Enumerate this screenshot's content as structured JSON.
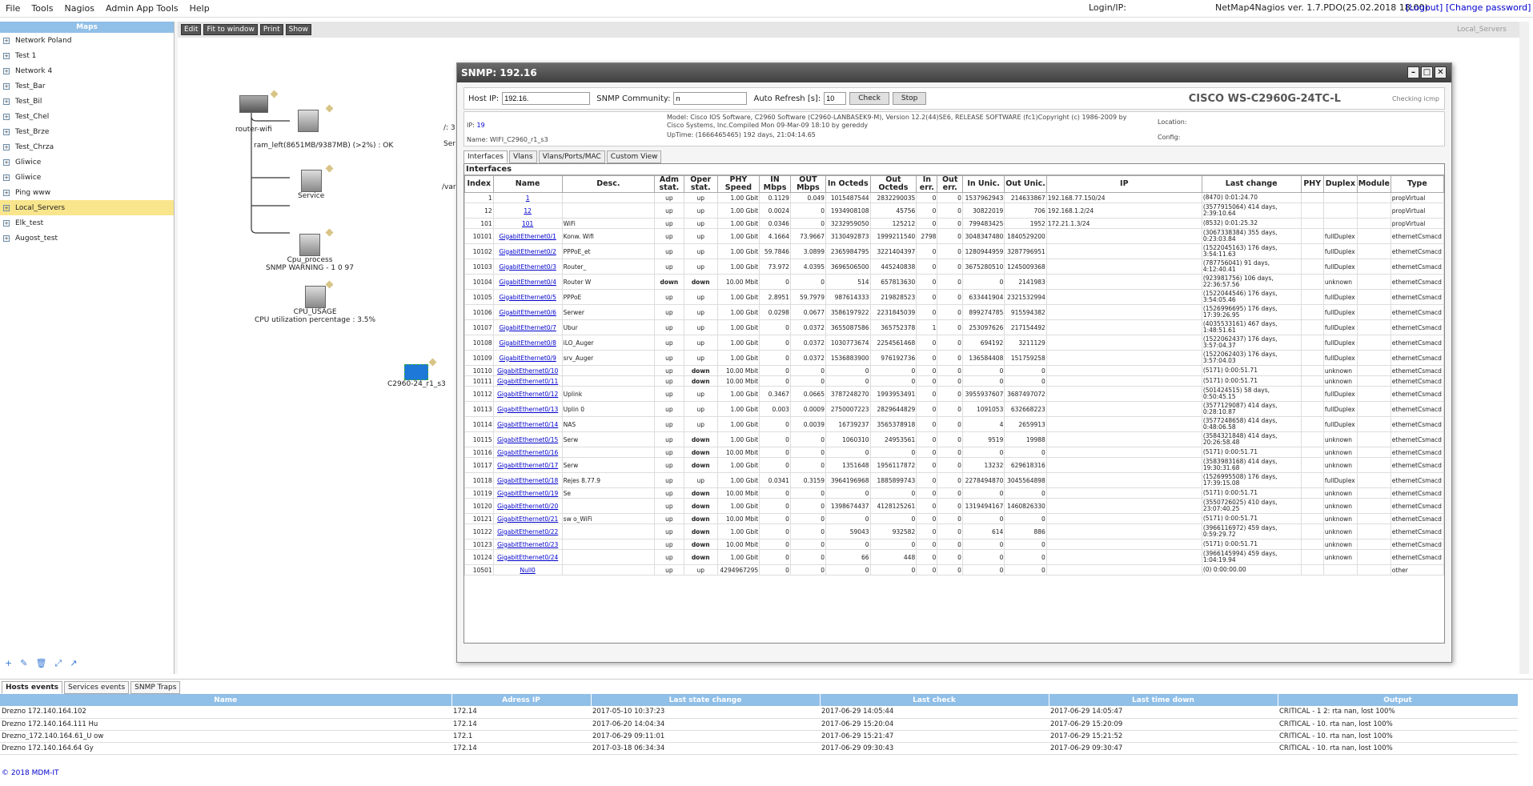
{
  "menu": {
    "items": [
      "File",
      "Tools",
      "Nagios",
      "Admin App Tools",
      "Help"
    ],
    "login": "Login/IP:",
    "version": "NetMap4Nagios ver. 1.7.PDO(25.02.2018 18:00)",
    "logout": "[Logout]",
    "change_password": "[Change password]"
  },
  "sidebar": {
    "title": "Maps",
    "items": [
      "Network Poland",
      "Test 1",
      "Network 4",
      "Test_Bar",
      "Test_Bil",
      "Test_Chel",
      "Test_Brze",
      "Test_Chrza",
      "Gliwice",
      "Gliwice",
      "Ping www",
      "Local_Servers",
      "Elk_test",
      "Augost_test"
    ],
    "selected": "Local_Servers"
  },
  "toolbar": {
    "edit": "Edit",
    "fit": "Fit to window",
    "print": "Print",
    "show": "Show",
    "map_name": "Local_Servers"
  },
  "map": {
    "router_label": "router-wifi",
    "ram_label": "ram_left(8651MB/9387MB) (>2%) : OK",
    "service_label": "Service",
    "cpu_process_label": "Cpu_process",
    "cpu_process_status": "SNMP WARNING - 1 0 97",
    "cpu_usage_label": "CPU_USAGE",
    "cpu_usage_status": "CPU utilization percentage : 3.5%",
    "switch_label": "C2960-24_r1_s3",
    "frag1": "/: 3",
    "frag2": "Ser",
    "frag3": "/var"
  },
  "snmp": {
    "title": "SNMP: 192.16",
    "host_ip_label": "Host IP:",
    "host_ip": "192.16.",
    "community_label": "SNMP Community:",
    "community": "n",
    "refresh_label": "Auto Refresh [s]:",
    "refresh": "10",
    "check": "Check",
    "stop": "Stop",
    "model": "CISCO WS-C2960G-24TC-L",
    "checking": "Checking icmp",
    "ip_label": "IP:",
    "ip": "19",
    "name_label": "Name: WIFI_C2960_r1_s3",
    "desc": "Model: Cisco IOS Software, C2960 Software (C2960-LANBASEK9-M), Version 12.2(44)SE6, RELEASE SOFTWARE (fc1)Copyright (c) 1986-2009 by",
    "desc2": "Cisco Systems, Inc.Compiled Mon 09-Mar-09 18:10 by gereddy",
    "uptime": "UpTime: (1666465465) 192 days, 21:04:14.65",
    "location": "Location:",
    "config": "Config:",
    "tabs": [
      "Interfaces",
      "Vlans",
      "Vlans/Ports/MAC",
      "Custom View"
    ],
    "panel_title": "Interfaces",
    "columns": [
      "Index",
      "Name",
      "Desc.",
      "Adm stat.",
      "Oper stat.",
      "PHY Speed",
      "IN Mbps",
      "OUT Mbps",
      "In Octeds",
      "Out Octeds",
      "In err.",
      "Out err.",
      "In Unic.",
      "Out Unic.",
      "IP",
      "Last change",
      "PHY",
      "Duplex",
      "Module",
      "Type"
    ],
    "rows": [
      [
        "1",
        "1",
        "",
        "up",
        "up",
        "1.00 Gbit",
        "0.1129",
        "0.049",
        "1015487544",
        "2832290035",
        "0",
        "0",
        "1537962943",
        "214633867",
        "192.168.77.150/24",
        "(8470) 0:01:24.70",
        "",
        "",
        "",
        "propVirtual"
      ],
      [
        "12",
        "12",
        "",
        "up",
        "up",
        "1.00 Gbit",
        "0.0024",
        "0",
        "1934908108",
        "45756",
        "0",
        "0",
        "30822019",
        "706",
        "192.168.1.2/24",
        "(3577915064) 414 days, 2:39:10.64",
        "",
        "",
        "",
        "propVirtual"
      ],
      [
        "101",
        "101",
        "WiFi",
        "up",
        "up",
        "1.00 Gbit",
        "0.0346",
        "0",
        "3232959050",
        "125212",
        "0",
        "0",
        "799483425",
        "1952",
        "172.21.1.3/24",
        "(8532) 0:01:25.32",
        "",
        "",
        "",
        "propVirtual"
      ],
      [
        "10101",
        "GigabitEthernet0/1",
        "Konw.   Wifi",
        "up",
        "up",
        "1.00 Gbit",
        "4.1664",
        "73.9667",
        "3130492873",
        "1999211540",
        "2798",
        "0",
        "3048347480",
        "1840529200",
        "",
        "(3067338384) 355 days, 0:23:03.84",
        "",
        "fullDuplex",
        "",
        "ethernetCsmacd"
      ],
      [
        "10102",
        "GigabitEthernet0/2",
        "PPPoE_et",
        "up",
        "up",
        "1.00 Gbit",
        "59.7846",
        "3.0899",
        "2365984795",
        "3221404397",
        "0",
        "0",
        "1280944959",
        "3287796951",
        "",
        "(1522045163) 176 days, 3:54:11.63",
        "",
        "fullDuplex",
        "",
        "ethernetCsmacd"
      ],
      [
        "10103",
        "GigabitEthernet0/3",
        "Router_",
        "up",
        "up",
        "1.00 Gbit",
        "73.972",
        "4.0395",
        "3696506500",
        "445240838",
        "0",
        "0",
        "3675280510",
        "1245009368",
        "",
        "(787756041) 91 days, 4:12:40.41",
        "",
        "fullDuplex",
        "",
        "ethernetCsmacd"
      ],
      [
        "10104",
        "GigabitEthernet0/4",
        "Router W",
        "down",
        "down",
        "10.00 Mbit",
        "0",
        "0",
        "514",
        "657813630",
        "0",
        "0",
        "0",
        "2141983",
        "",
        "(923981756) 106 days, 22:36:57.56",
        "",
        "unknown",
        "",
        "ethernetCsmacd"
      ],
      [
        "10105",
        "GigabitEthernet0/5",
        "PPPoE",
        "up",
        "up",
        "1.00 Gbit",
        "2.8951",
        "59.7979",
        "987614333",
        "219828523",
        "0",
        "0",
        "633441904",
        "2321532994",
        "",
        "(1522044546) 176 days, 3:54:05.46",
        "",
        "fullDuplex",
        "",
        "ethernetCsmacd"
      ],
      [
        "10106",
        "GigabitEthernet0/6",
        "Serwer",
        "up",
        "up",
        "1.00 Gbit",
        "0.0298",
        "0.0677",
        "3586197922",
        "2231845039",
        "0",
        "0",
        "899274785",
        "915594382",
        "",
        "(1526996695) 176 days, 17:39:26.95",
        "",
        "fullDuplex",
        "",
        "ethernetCsmacd"
      ],
      [
        "10107",
        "GigabitEthernet0/7",
        "Ubur",
        "up",
        "up",
        "1.00 Gbit",
        "0",
        "0.0372",
        "3655087586",
        "365752378",
        "1",
        "0",
        "253097626",
        "217154492",
        "",
        "(4035533161) 467 days, 1:48:51.61",
        "",
        "fullDuplex",
        "",
        "ethernetCsmacd"
      ],
      [
        "10108",
        "GigabitEthernet0/8",
        "iLO_Auger",
        "up",
        "up",
        "1.00 Gbit",
        "0",
        "0.0372",
        "1030773674",
        "2254561468",
        "0",
        "0",
        "694192",
        "3211129",
        "",
        "(1522062437) 176 days, 3:57:04.37",
        "",
        "fullDuplex",
        "",
        "ethernetCsmacd"
      ],
      [
        "10109",
        "GigabitEthernet0/9",
        "srv_Auger",
        "up",
        "up",
        "1.00 Gbit",
        "0",
        "0.0372",
        "1536883900",
        "976192736",
        "0",
        "0",
        "136584408",
        "151759258",
        "",
        "(1522062403) 176 days, 3:57:04.03",
        "",
        "fullDuplex",
        "",
        "ethernetCsmacd"
      ],
      [
        "10110",
        "GigabitEthernet0/10",
        "",
        "up",
        "down",
        "10.00 Mbit",
        "0",
        "0",
        "0",
        "0",
        "0",
        "0",
        "0",
        "0",
        "",
        "(5171) 0:00:51.71",
        "",
        "unknown",
        "",
        "ethernetCsmacd"
      ],
      [
        "10111",
        "GigabitEthernet0/11",
        "",
        "up",
        "down",
        "10.00 Mbit",
        "0",
        "0",
        "0",
        "0",
        "0",
        "0",
        "0",
        "0",
        "",
        "(5171) 0:00:51.71",
        "",
        "unknown",
        "",
        "ethernetCsmacd"
      ],
      [
        "10112",
        "GigabitEthernet0/12",
        "Uplink",
        "up",
        "up",
        "1.00 Gbit",
        "0.3467",
        "0.0665",
        "3787248270",
        "1993953491",
        "0",
        "0",
        "3955937607",
        "3687497072",
        "",
        "(501424515) 58 days, 0:50:45.15",
        "",
        "fullDuplex",
        "",
        "ethernetCsmacd"
      ],
      [
        "10113",
        "GigabitEthernet0/13",
        "Uplin   0",
        "up",
        "up",
        "1.00 Gbit",
        "0.003",
        "0.0009",
        "2750007223",
        "2829644829",
        "0",
        "0",
        "1091053",
        "632668223",
        "",
        "(3577129087) 414 days, 0:28:10.87",
        "",
        "fullDuplex",
        "",
        "ethernetCsmacd"
      ],
      [
        "10114",
        "GigabitEthernet0/14",
        "NAS",
        "up",
        "up",
        "1.00 Gbit",
        "0",
        "0.0039",
        "16739237",
        "3565378918",
        "0",
        "0",
        "4",
        "2659913",
        "",
        "(3577248658) 414 days, 0:48:06.58",
        "",
        "fullDuplex",
        "",
        "ethernetCsmacd"
      ],
      [
        "10115",
        "GigabitEthernet0/15",
        "Serw",
        "up",
        "down",
        "1.00 Gbit",
        "0",
        "0",
        "1060310",
        "24953561",
        "0",
        "0",
        "9519",
        "19988",
        "",
        "(3584321848) 414 days, 20:26:58.48",
        "",
        "unknown",
        "",
        "ethernetCsmacd"
      ],
      [
        "10116",
        "GigabitEthernet0/16",
        "",
        "up",
        "down",
        "10.00 Mbit",
        "0",
        "0",
        "0",
        "0",
        "0",
        "0",
        "0",
        "0",
        "",
        "(5171) 0:00:51.71",
        "",
        "unknown",
        "",
        "ethernetCsmacd"
      ],
      [
        "10117",
        "GigabitEthernet0/17",
        "Serw",
        "up",
        "down",
        "1.00 Gbit",
        "0",
        "0",
        "1351648",
        "1956117872",
        "0",
        "0",
        "13232",
        "629618316",
        "",
        "(3583983168) 414 days, 19:30:31.68",
        "",
        "unknown",
        "",
        "ethernetCsmacd"
      ],
      [
        "10118",
        "GigabitEthernet0/18",
        "Rejes   8.77.9",
        "up",
        "up",
        "1.00 Gbit",
        "0.0341",
        "0.3159",
        "3964196968",
        "1885899743",
        "0",
        "0",
        "2278494870",
        "3045564898",
        "",
        "(1526995508) 176 days, 17:39:15.08",
        "",
        "fullDuplex",
        "",
        "ethernetCsmacd"
      ],
      [
        "10119",
        "GigabitEthernet0/19",
        "Se",
        "up",
        "down",
        "10.00 Mbit",
        "0",
        "0",
        "0",
        "0",
        "0",
        "0",
        "0",
        "0",
        "",
        "(5171) 0:00:51.71",
        "",
        "unknown",
        "",
        "ethernetCsmacd"
      ],
      [
        "10120",
        "GigabitEthernet0/20",
        "",
        "up",
        "down",
        "1.00 Gbit",
        "0",
        "0",
        "1398674437",
        "4128125261",
        "0",
        "0",
        "1319494167",
        "1460826330",
        "",
        "(3550726025) 410 days, 23:07:40.25",
        "",
        "unknown",
        "",
        "ethernetCsmacd"
      ],
      [
        "10121",
        "GigabitEthernet0/21",
        "sw   o_WiFi",
        "up",
        "down",
        "10.00 Mbit",
        "0",
        "0",
        "0",
        "0",
        "0",
        "0",
        "0",
        "0",
        "",
        "(5171) 0:00:51.71",
        "",
        "unknown",
        "",
        "ethernetCsmacd"
      ],
      [
        "10122",
        "GigabitEthernet0/22",
        "",
        "up",
        "down",
        "1.00 Gbit",
        "0",
        "0",
        "59043",
        "932582",
        "0",
        "0",
        "614",
        "886",
        "",
        "(3966116972) 459 days, 0:59:29.72",
        "",
        "unknown",
        "",
        "ethernetCsmacd"
      ],
      [
        "10123",
        "GigabitEthernet0/23",
        "",
        "up",
        "down",
        "10.00 Mbit",
        "0",
        "0",
        "0",
        "0",
        "0",
        "0",
        "0",
        "0",
        "",
        "(5171) 0:00:51.71",
        "",
        "unknown",
        "",
        "ethernetCsmacd"
      ],
      [
        "10124",
        "GigabitEthernet0/24",
        "",
        "up",
        "down",
        "1.00 Gbit",
        "0",
        "0",
        "66",
        "448",
        "0",
        "0",
        "0",
        "0",
        "",
        "(3966145994) 459 days, 1:04:19.94",
        "",
        "unknown",
        "",
        "ethernetCsmacd"
      ],
      [
        "10501",
        "Null0",
        "",
        "up",
        "up",
        "4294967295",
        "0",
        "0",
        "0",
        "0",
        "0",
        "0",
        "0",
        "0",
        "",
        "(0) 0:00:00.00",
        "",
        "",
        "",
        "other"
      ]
    ]
  },
  "bottom": {
    "tabs": [
      "Hosts events",
      "Services events",
      "SNMP Traps"
    ],
    "columns": [
      "Name",
      "Adress IP",
      "Last state change",
      "Last check",
      "Last time down",
      "Output"
    ],
    "rows": [
      [
        "Drezno 172.140.164.102",
        "172.14",
        "2017-05-10 10:37:23",
        "2017-06-29 14:05:44",
        "2017-06-29 14:05:47",
        "CRITICAL - 1   2: rta nan, lost 100%"
      ],
      [
        "Drezno 172.140.164.111 Hu",
        "172.14",
        "2017-06-20 14:04:34",
        "2017-06-29 15:20:04",
        "2017-06-29 15:20:09",
        "CRITICAL - 10.   rta nan, lost 100%"
      ],
      [
        "Drezno_172.140.164.61_U   ow",
        "172.1",
        "2017-06-29 09:11:01",
        "2017-06-29 15:21:47",
        "2017-06-29 15:21:52",
        "CRITICAL - 10.   rta nan, lost 100%"
      ],
      [
        "Drezno 172.140.164.64 Gy",
        "172.14",
        "2017-03-18 06:34:34",
        "2017-06-29 09:30:43",
        "2017-06-29 09:30:47",
        "CRITICAL - 10.   rta nan, lost 100%"
      ]
    ]
  },
  "footer": "© 2018 MDM-IT"
}
